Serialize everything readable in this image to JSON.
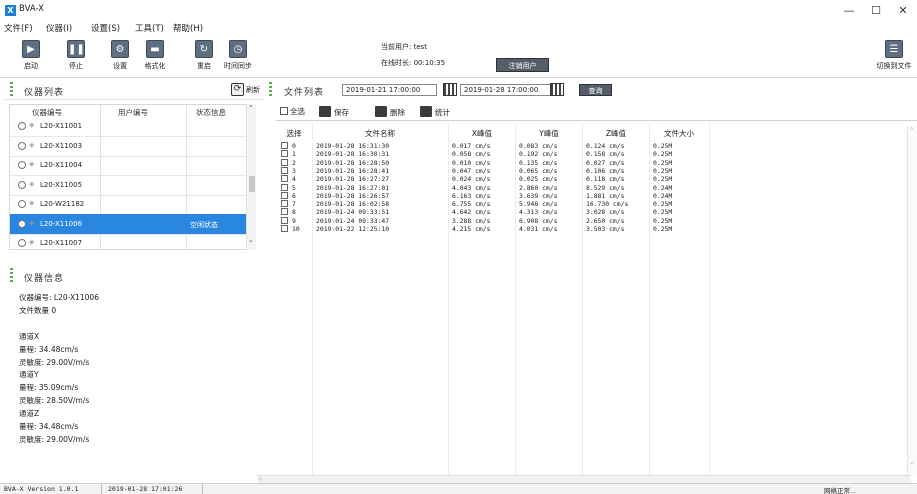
{
  "window": {
    "title": "BVA-X",
    "logo_letter": "X",
    "minimize": "—",
    "maximize": "☐",
    "close": "✕"
  },
  "menu": [
    "文件(F)",
    "仪器(I)",
    "设置(S)",
    "工具(T)",
    "帮助(H)"
  ],
  "toolbar": {
    "start": "启动",
    "stop": "停止",
    "settings": "设置",
    "format": "格式化",
    "restart": "重启",
    "time_sync": "时间同步",
    "switch_to_file": "切换到文件"
  },
  "user": {
    "current_user": "当前用户: test",
    "online_time": "在线时长: 00:10:35",
    "logout": "注销用户"
  },
  "device_panel": {
    "title": "仪器列表",
    "refresh": "刷新",
    "columns": [
      "仪器编号",
      "用户编号",
      "状态信息"
    ],
    "rows": [
      {
        "id": "L20-X11001",
        "user": "",
        "status": ""
      },
      {
        "id": "L20-X11003",
        "user": "",
        "status": ""
      },
      {
        "id": "L20-X11004",
        "user": "",
        "status": ""
      },
      {
        "id": "L20-X11005",
        "user": "",
        "status": ""
      },
      {
        "id": "L20-W21182",
        "user": "",
        "status": ""
      },
      {
        "id": "L20-X11006",
        "user": "",
        "status": "空闲状态"
      },
      {
        "id": "L20-X11007",
        "user": "",
        "status": ""
      }
    ],
    "selected_row_index": 5
  },
  "device_info": {
    "title": "仪器信息",
    "lines": [
      "仪器编号: L20-X11006",
      "文件数量  0",
      "",
      "通道X",
      "量程:  34.48cm/s",
      "灵敏度: 29.00V/m/s",
      "通道Y",
      "量程:  35.09cm/s",
      "灵敏度: 28.50V/m/s",
      "通道Z",
      "量程:  34.48cm/s",
      "灵敏度: 29.00V/m/s"
    ]
  },
  "file_panel": {
    "title": "文件列表",
    "date_from": "2019-01-21 17:00:00",
    "date_to": "2019-01-28 17:00:00",
    "query": "查询",
    "select_all": "全选",
    "save": "保存",
    "delete": "删除",
    "stats": "统计",
    "columns": [
      "选择",
      "文件名称",
      "X峰值",
      "Y峰值",
      "Z峰值",
      "文件大小"
    ],
    "rows": [
      [
        "0",
        "2019-01-28 16:31:30",
        "0.017 cm/s",
        "0.083 cm/s",
        "0.124 cm/s",
        "0.25M"
      ],
      [
        "1",
        "2019-01-28 16:30:31",
        "0.058 cm/s",
        "0.192 cm/s",
        "0.158 cm/s",
        "0.25M"
      ],
      [
        "2",
        "2019-01-28 16:28:50",
        "0.010 cm/s",
        "0.135 cm/s",
        "0.027 cm/s",
        "0.25M"
      ],
      [
        "3",
        "2019-01-28 16:28:41",
        "0.047 cm/s",
        "0.065 cm/s",
        "0.106 cm/s",
        "0.25M"
      ],
      [
        "4",
        "2019-01-28 16:27:27",
        "0.024 cm/s",
        "0.025 cm/s",
        "0.118 cm/s",
        "0.25M"
      ],
      [
        "5",
        "2019-01-28 16:27:01",
        "4.043 cm/s",
        "2.860 cm/s",
        "8.529 cm/s",
        "0.24M"
      ],
      [
        "6",
        "2019-01-28 16:26:57",
        "6.163 cm/s",
        "3.639 cm/s",
        "1.881 cm/s",
        "0.24M"
      ],
      [
        "7",
        "2019-01-28 16:02:58",
        "6.755 cm/s",
        "5.948 cm/s",
        "16.730 cm/s",
        "0.25M"
      ],
      [
        "8",
        "2019-01-24 09:33:51",
        "4.642 cm/s",
        "4.313 cm/s",
        "3.028 cm/s",
        "0.25M"
      ],
      [
        "9",
        "2019-01-24 09:33:47",
        "3.288 cm/s",
        "6.908 cm/s",
        "2.650 cm/s",
        "0.25M"
      ],
      [
        "10",
        "2019-01-22 12:25:10",
        "4.215 cm/s",
        "4.031 cm/s",
        "3.503 cm/s",
        "0.25M"
      ]
    ]
  },
  "status": {
    "version": "BVA-X Version 1.0.1",
    "datetime": "2019-01-28 17:01:26",
    "network": "网络正常..."
  },
  "colors": {
    "selection": "#2a87e0",
    "grip": "#58b04a",
    "dark_button": "#545e6b"
  },
  "icons": {
    "start": "play-icon",
    "stop": "pause-icon",
    "settings": "gear-icon",
    "format": "drive-icon",
    "restart": "restart-icon",
    "time_sync": "clock-icon",
    "switch": "switch-icon",
    "refresh": "refresh-icon",
    "calendar": "calendar-icon",
    "save": "floppy-icon",
    "delete": "trash-icon",
    "stats": "stats-icon"
  }
}
